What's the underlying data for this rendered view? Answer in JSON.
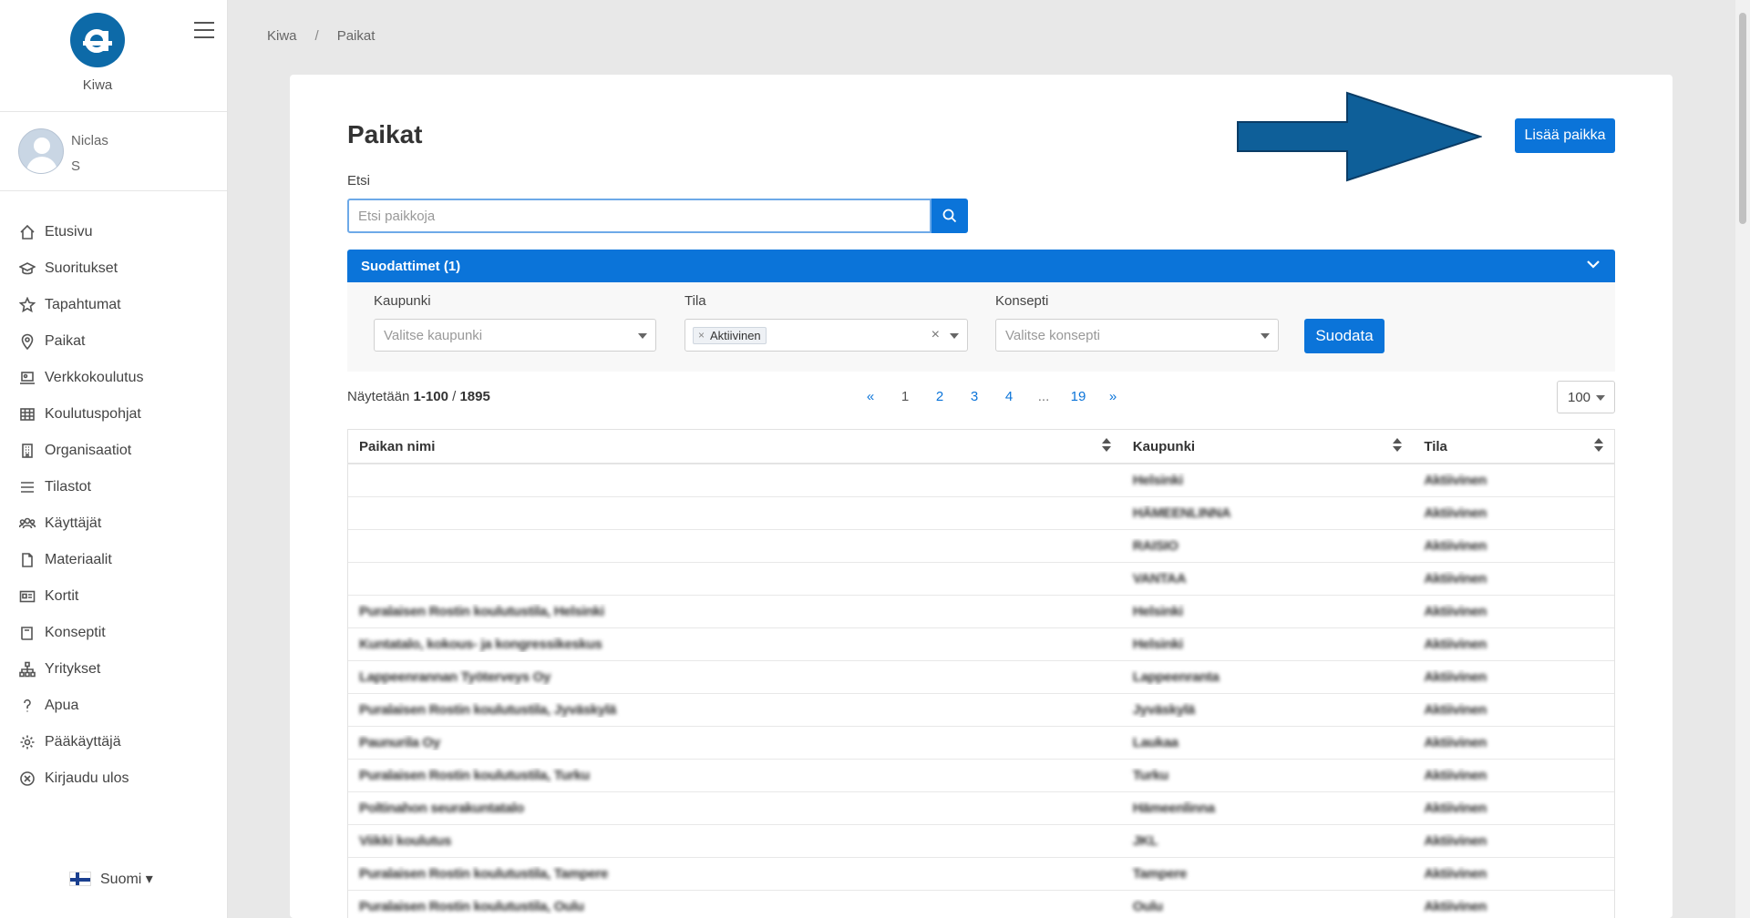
{
  "app": {
    "brand_name": "Kiwa"
  },
  "user": {
    "first_name": "Niclas",
    "last_name": "S"
  },
  "nav": [
    {
      "label": "Etusivu",
      "icon": "home-icon"
    },
    {
      "label": "Suoritukset",
      "icon": "graduation-cap-icon"
    },
    {
      "label": "Tapahtumat",
      "icon": "star-icon"
    },
    {
      "label": "Paikat",
      "icon": "map-pin-icon"
    },
    {
      "label": "Verkkokoulutus",
      "icon": "laptop-icon"
    },
    {
      "label": "Koulutuspohjat",
      "icon": "table-icon"
    },
    {
      "label": "Organisaatiot",
      "icon": "building-icon"
    },
    {
      "label": "Tilastot",
      "icon": "bars-icon"
    },
    {
      "label": "Käyttäjät",
      "icon": "users-icon"
    },
    {
      "label": "Materiaalit",
      "icon": "file-icon"
    },
    {
      "label": "Kortit",
      "icon": "id-card-icon"
    },
    {
      "label": "Konseptit",
      "icon": "book-icon"
    },
    {
      "label": "Yritykset",
      "icon": "sitemap-icon"
    },
    {
      "label": "Apua",
      "icon": "question-icon"
    },
    {
      "label": "Pääkäyttäjä",
      "icon": "gear-icon"
    },
    {
      "label": "Kirjaudu ulos",
      "icon": "close-circle-icon"
    }
  ],
  "language": {
    "label": "Suomi ▾"
  },
  "breadcrumb": {
    "root": "Kiwa",
    "sep": "/",
    "current": "Paikat"
  },
  "page": {
    "title": "Paikat",
    "add_button": "Lisää paikka",
    "search_label": "Etsi",
    "search_placeholder": "Etsi paikkoja"
  },
  "filters": {
    "header": "Suodattimet (1)",
    "city_label": "Kaupunki",
    "city_placeholder": "Valitse kaupunki",
    "status_label": "Tila",
    "status_tag": "Aktiivinen",
    "concept_label": "Konsepti",
    "concept_placeholder": "Valitse konsepti",
    "apply_button": "Suodata"
  },
  "listing": {
    "showing_prefix": "Näytetään ",
    "range": "1-100",
    "slash": " / ",
    "total": "1895",
    "pages": [
      "«",
      "1",
      "2",
      "3",
      "4",
      "...",
      "19",
      "»"
    ],
    "per_page": "100"
  },
  "table": {
    "columns": [
      "Paikan nimi",
      "Kaupunki",
      "Tila"
    ],
    "rows": [
      {
        "name": "",
        "city": "Helsinki",
        "status": "Aktiivinen"
      },
      {
        "name": "",
        "city": "HÄMEENLINNA",
        "status": "Aktiivinen"
      },
      {
        "name": "",
        "city": "RAISIO",
        "status": "Aktiivinen"
      },
      {
        "name": "",
        "city": "VANTAA",
        "status": "Aktiivinen"
      },
      {
        "name": "Puralaisen Rostin koulutustila, Helsinki",
        "city": "Helsinki",
        "status": "Aktiivinen"
      },
      {
        "name": "Kuntatalo, kokous- ja kongressikeskus",
        "city": "Helsinki",
        "status": "Aktiivinen"
      },
      {
        "name": "Lappeenrannan Työterveys Oy",
        "city": "Lappeenranta",
        "status": "Aktiivinen"
      },
      {
        "name": "Puralaisen Rostin koulutustila, Jyväskylä",
        "city": "Jyväskylä",
        "status": "Aktiivinen"
      },
      {
        "name": "Paunurila Oy",
        "city": "Laukaa",
        "status": "Aktiivinen"
      },
      {
        "name": "Puralaisen Rostin koulutustila, Turku",
        "city": "Turku",
        "status": "Aktiivinen"
      },
      {
        "name": "Poltinahon seurakuntatalo",
        "city": "Hämeenlinna",
        "status": "Aktiivinen"
      },
      {
        "name": "Viikki koulutus",
        "city": "JKL",
        "status": "Aktiivinen"
      },
      {
        "name": "Puralaisen Rostin koulutustila, Tampere",
        "city": "Tampere",
        "status": "Aktiivinen"
      },
      {
        "name": "Puralaisen Rostin koulutustila, Oulu",
        "city": "Oulu",
        "status": "Aktiivinen"
      }
    ]
  }
}
